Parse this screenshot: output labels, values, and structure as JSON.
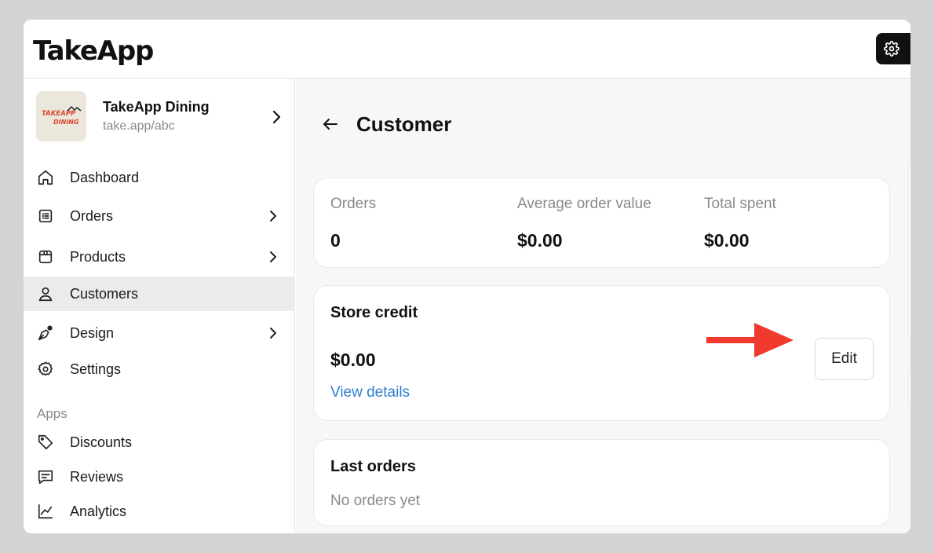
{
  "app": {
    "logo": "TakeApp"
  },
  "store": {
    "name": "TakeApp Dining",
    "url": "take.app/abc",
    "logo_text_1": "TAKEAPP",
    "logo_text_2": "DINING"
  },
  "sidebar": {
    "items": [
      {
        "label": "Dashboard",
        "icon": "home-icon"
      },
      {
        "label": "Orders",
        "icon": "list-icon"
      },
      {
        "label": "Products",
        "icon": "box-icon"
      },
      {
        "label": "Customers",
        "icon": "user-icon"
      },
      {
        "label": "Design",
        "icon": "pen-icon"
      },
      {
        "label": "Settings",
        "icon": "gear-icon"
      }
    ],
    "apps_label": "Apps",
    "apps": [
      {
        "label": "Discounts",
        "icon": "tag-icon"
      },
      {
        "label": "Reviews",
        "icon": "message-icon"
      },
      {
        "label": "Analytics",
        "icon": "chart-icon"
      }
    ]
  },
  "page": {
    "title": "Customer"
  },
  "stats": [
    {
      "label": "Orders",
      "value": "0"
    },
    {
      "label": "Average order value",
      "value": "$0.00"
    },
    {
      "label": "Total spent",
      "value": "$0.00"
    }
  ],
  "store_credit": {
    "title": "Store credit",
    "value": "$0.00",
    "link": "View details",
    "edit_label": "Edit"
  },
  "last_orders": {
    "title": "Last orders",
    "empty": "No orders yet"
  },
  "colors": {
    "link": "#2f7fcf",
    "annotation_arrow": "#f03a2e",
    "active_bg": "#ebebeb"
  }
}
